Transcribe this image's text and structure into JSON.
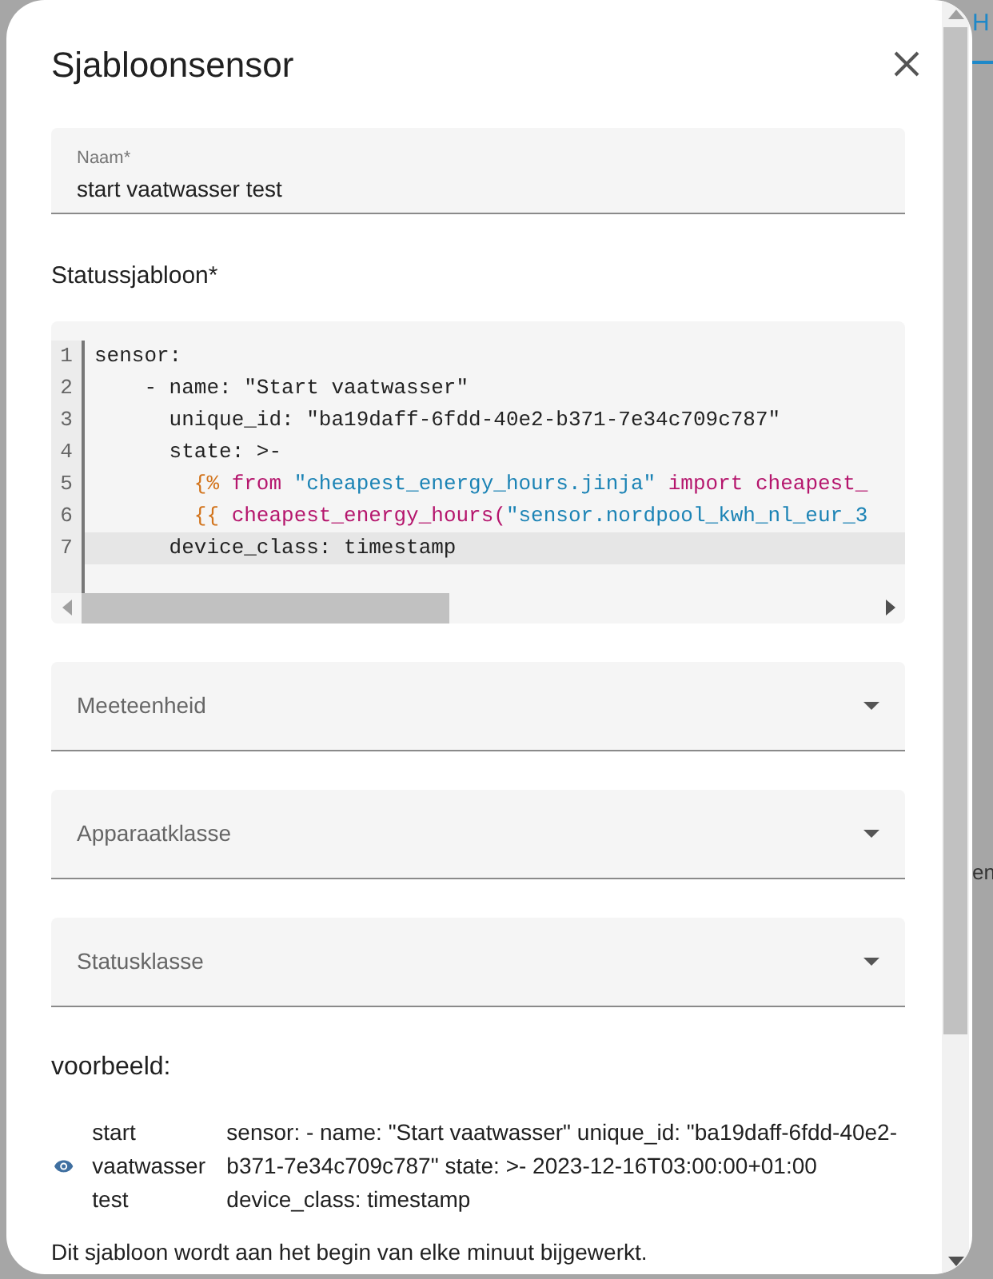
{
  "background": {
    "tab_label": "H",
    "text_fragment": "en"
  },
  "dialog": {
    "title": "Sjabloonsensor"
  },
  "name_field": {
    "label": "Naam*",
    "value": "start vaatwasser test"
  },
  "template_label": "Statussjabloon*",
  "editor": {
    "lines": [
      {
        "number": "1",
        "active": false,
        "tokens": [
          {
            "kind": "plain",
            "text": "sensor:"
          }
        ]
      },
      {
        "number": "2",
        "active": false,
        "tokens": [
          {
            "kind": "plain",
            "text": "    - name: \"Start vaatwasser\""
          }
        ]
      },
      {
        "number": "3",
        "active": false,
        "tokens": [
          {
            "kind": "plain",
            "text": "      unique_id: \"ba19daff-6fdd-40e2-b371-7e34c709c787\""
          }
        ]
      },
      {
        "number": "4",
        "active": false,
        "tokens": [
          {
            "kind": "plain",
            "text": "      state: >-"
          }
        ]
      },
      {
        "number": "5",
        "active": false,
        "tokens": [
          {
            "kind": "delimiter",
            "text": "        {%"
          },
          {
            "kind": "keyword",
            "text": " from "
          },
          {
            "kind": "string",
            "text": "\"cheapest_energy_hours.jinja\""
          },
          {
            "kind": "keyword",
            "text": " import cheapest_"
          }
        ]
      },
      {
        "number": "6",
        "active": false,
        "tokens": [
          {
            "kind": "delimiter",
            "text": "        {{"
          },
          {
            "kind": "keyword",
            "text": " cheapest_energy_hours("
          },
          {
            "kind": "string",
            "text": "\"sensor.nordpool_kwh_nl_eur_3"
          }
        ]
      },
      {
        "number": "7",
        "active": true,
        "tokens": [
          {
            "kind": "plain",
            "text": "      device_class: timestamp"
          }
        ]
      }
    ]
  },
  "selects": [
    {
      "label": "Meeteenheid"
    },
    {
      "label": "Apparaatklasse"
    },
    {
      "label": "Statusklasse"
    }
  ],
  "preview": {
    "heading": "voorbeeld:",
    "entity_name": "start vaatwasser test",
    "state": "sensor: - name: \"Start vaatwasser\" unique_id: \"ba19daff-6fdd-40e2-b371-7e34c709c787\" state: >- 2023-12-16T03:00:00+01:00 device_class: timestamp"
  },
  "note": "Dit sjabloon wordt aan het begin van elke minuut bijgewerkt."
}
